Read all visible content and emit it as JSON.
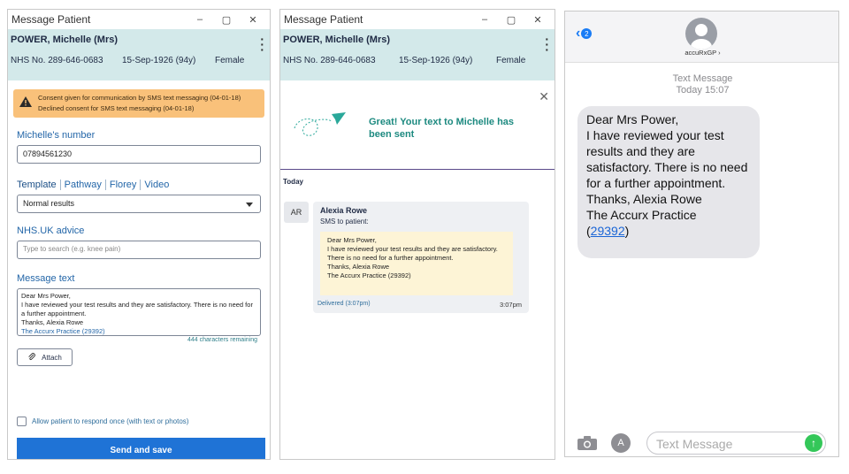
{
  "colors": {
    "accent": "#1f73d6",
    "patient_bar": "#d3e9ea",
    "consent_bg": "#f9c17a",
    "success_text": "#1d8a80",
    "ios_send": "#34c759"
  },
  "panel1": {
    "title": "Message Patient",
    "win_min": "–",
    "win_max": "▢",
    "win_close": "✕",
    "patient": {
      "name": "POWER, Michelle (Mrs)",
      "nhs": "NHS No. 289-646-0683",
      "dob": "15-Sep-1926 (94y)",
      "gender": "Female"
    },
    "consent_lines": [
      "Consent given for communication by SMS text messaging (04-01-18)",
      "Declined consent for SMS text messaging (04-01-18)"
    ],
    "number_label": "Michelle's number",
    "number_value": "07894561230",
    "tabs": [
      "Template",
      "Pathway",
      "Florey",
      "Video"
    ],
    "template_value": "Normal results",
    "nhs_label": "NHS.UK advice",
    "nhs_placeholder": "Type to search (e.g. knee pain)",
    "message_label": "Message text",
    "message_lines": [
      "Dear Mrs Power,",
      "I have reviewed your test results and they are satisfactory. There is no need for a further appointment.",
      "Thanks, Alexia Rowe"
    ],
    "message_signature": "The Accurx Practice (29392)",
    "remaining": "444 characters remaining",
    "attach_label": "Attach",
    "allow_label": "Allow patient to respond once (with text or photos)",
    "send_label": "Send and save"
  },
  "panel2": {
    "title": "Message Patient",
    "win_min": "–",
    "win_max": "▢",
    "win_close": "✕",
    "patient": {
      "name": "POWER, Michelle (Mrs)",
      "nhs": "NHS No. 289-646-0683",
      "dob": "15-Sep-1926 (94y)",
      "gender": "Female"
    },
    "close": "✕",
    "sent_text": "Great! Your text to Michelle has been sent",
    "today": "Today",
    "avatar": "AR",
    "from": "Alexia Rowe",
    "to": "SMS to patient:",
    "body": [
      "Dear Mrs Power,",
      "I have reviewed your test results and they are satisfactory. There is no need for a further appointment.",
      "Thanks, Alexia Rowe",
      "The Accurx Practice (29392)"
    ],
    "delivered": "Delivered (3:07pm)",
    "time": "3:07pm"
  },
  "panel3": {
    "back_chevron": "‹",
    "back_badge": "2",
    "contact": "accuRxGP",
    "meta_line1": "Text Message",
    "meta_line2": "Today 15:07",
    "bubble_lines": [
      "Dear Mrs Power,",
      "I have reviewed your test results and they are satisfactory. There is no need for a further appointment.",
      "Thanks, Alexia Rowe",
      "The Accurx Practice"
    ],
    "bubble_link": "29392",
    "input_placeholder": "Text Message",
    "send_glyph": "↑"
  }
}
